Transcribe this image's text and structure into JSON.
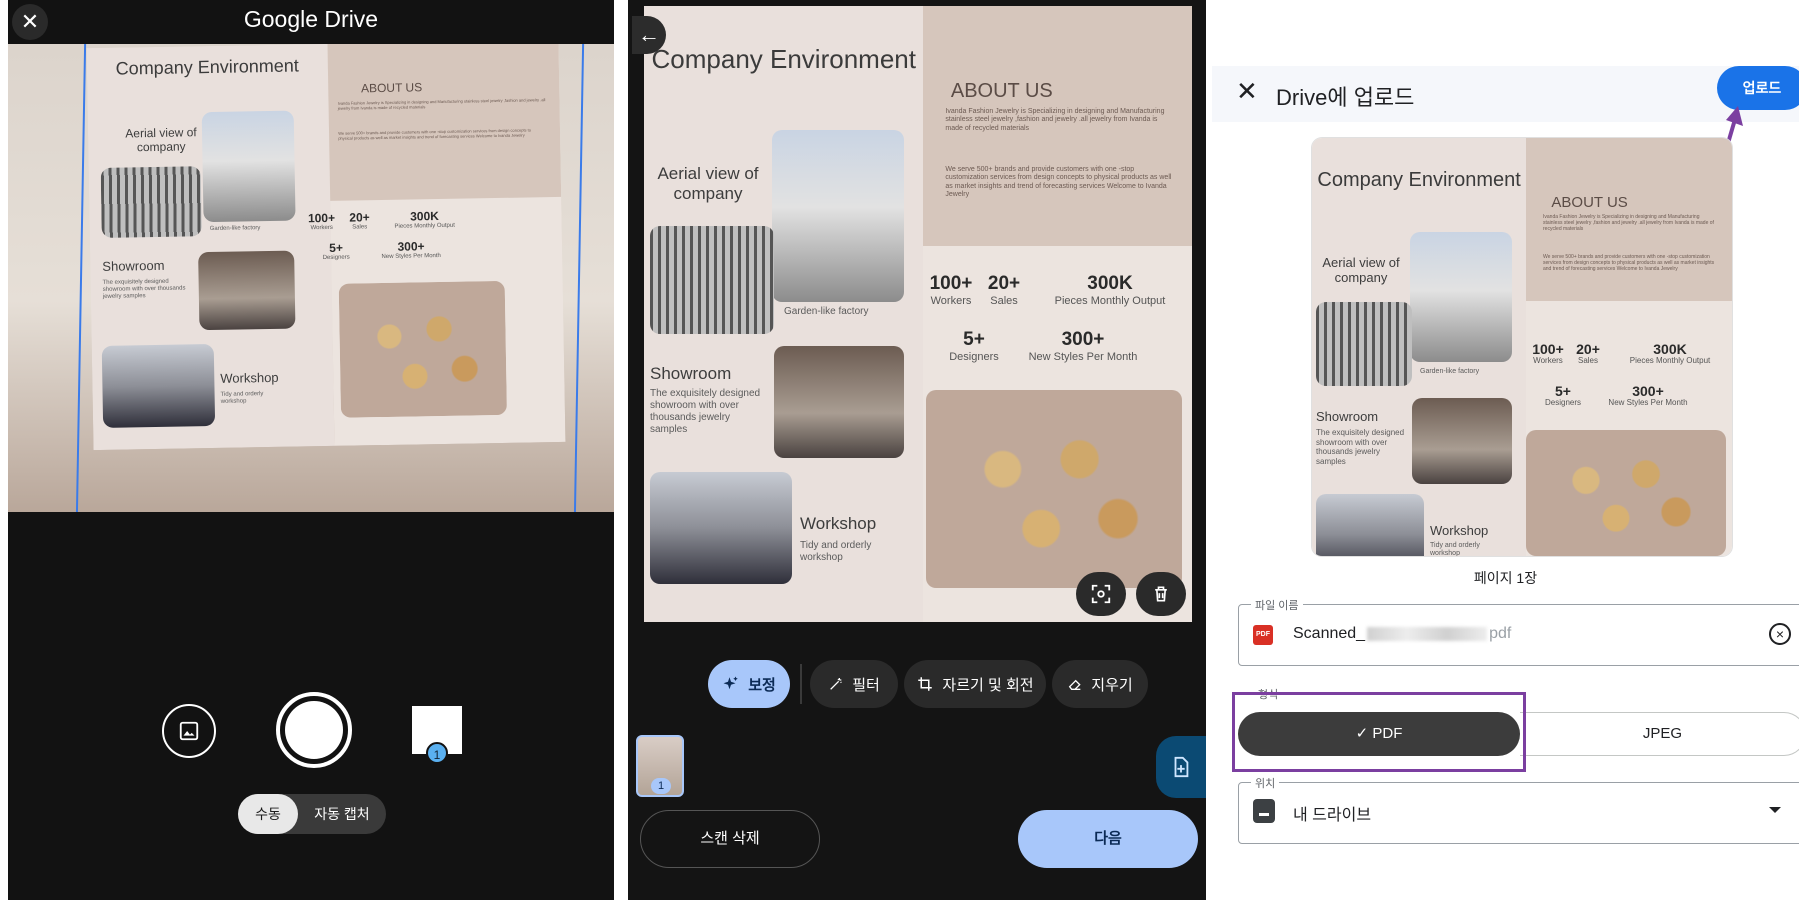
{
  "camera": {
    "close_icon": "✕",
    "title": "Google Drive",
    "thumbnail_count": "1",
    "mode_manual": "수동",
    "mode_auto": "자동 캡처"
  },
  "document": {
    "company_title": "Company Environment",
    "about_heading": "ABOUT US",
    "about_text_1": "Ivanda Fashion Jewelry is Specializing in designing and Manufacturing stainless steel jewelry ,fashion and jewelry .all jewelry from Ivanda is made of recycled materials",
    "about_text_2": "We serve 500+ brands and provide customers with one -stop customization services from design concepts to physical products as well as market insights and trend of forecasting services Welcome to Ivanda Jewelry",
    "aerial_label": "Aerial view of company",
    "garden_label": "Garden-like factory",
    "showroom_label": "Showroom",
    "showroom_desc": "The exquisitely designed showroom with over thousands jewelry samples",
    "workshop_label": "Workshop",
    "workshop_desc": "Tidy and orderly workshop",
    "stats": [
      {
        "value": "100+",
        "label": "Workers"
      },
      {
        "value": "20+",
        "label": "Sales"
      },
      {
        "value": "300K",
        "label": "Pieces Monthly Output"
      },
      {
        "value": "5+",
        "label": "Designers"
      },
      {
        "value": "300+",
        "label": "New Styles Per Month"
      }
    ]
  },
  "review": {
    "back_icon": "←",
    "tools": [
      {
        "label": "보정",
        "icon": "sparkle-icon"
      },
      {
        "label": "필터",
        "icon": "magic-wand-icon"
      },
      {
        "label": "자르기 및 회전",
        "icon": "crop-rotate-icon"
      },
      {
        "label": "지우기",
        "icon": "eraser-icon"
      }
    ],
    "page_badge": "1",
    "delete_scan": "스캔 삭제",
    "next": "다음"
  },
  "upload": {
    "close_icon": "✕",
    "title": "Drive에 업로드",
    "upload_button": "업로드",
    "page_count": "페이지 1장",
    "filename_label": "파일 이름",
    "filename_prefix": "Scanned_",
    "filename_ext": "pdf",
    "format_label": "형식",
    "format_pdf": "PDF",
    "format_jpeg": "JPEG",
    "location_label": "위치",
    "location_value": "내 드라이브",
    "annotation_color": "#7b3fa0",
    "accent_color": "#1a73e8"
  }
}
